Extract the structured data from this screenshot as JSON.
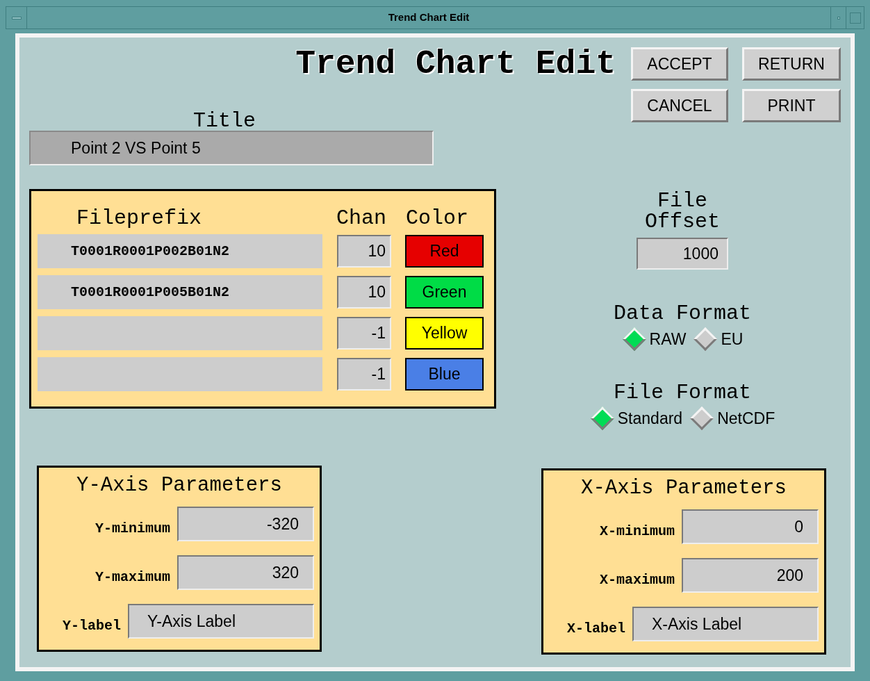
{
  "window": {
    "title": "Trend Chart Edit"
  },
  "heading": "Trend Chart Edit",
  "buttons": [
    {
      "label": "ACCEPT"
    },
    {
      "label": "RETURN"
    },
    {
      "label": "CANCEL"
    },
    {
      "label": "PRINT"
    }
  ],
  "title_field": {
    "label": "Title",
    "value": "Point 2 VS Point 5"
  },
  "channels": {
    "headers": [
      "Fileprefix",
      "Chan",
      "Color"
    ],
    "rows": [
      {
        "fileprefix": "T0001R0001P002B01N2",
        "chan": "10",
        "color_label": "Red",
        "color": "#e60000"
      },
      {
        "fileprefix": "T0001R0001P005B01N2",
        "chan": "10",
        "color_label": "Green",
        "color": "#00dc46"
      },
      {
        "chan": "-1",
        "color_label": "Yellow",
        "color": "#ffff00"
      },
      {
        "chan": "-1",
        "color_label": "Blue",
        "color": "#4a7fe6"
      }
    ]
  },
  "file_offset": {
    "label_lines": [
      "File",
      "Offset"
    ],
    "value": "1000"
  },
  "data_format": {
    "label": "Data Format",
    "options": [
      {
        "label": "RAW",
        "selected": true
      },
      {
        "label": "EU",
        "selected": false
      }
    ]
  },
  "file_format": {
    "label": "File Format",
    "options": [
      {
        "label": "Standard",
        "selected": true
      },
      {
        "label": "NetCDF",
        "selected": false
      }
    ]
  },
  "y_axis": {
    "title": "Y-Axis Parameters",
    "fields": [
      {
        "label": "Y-minimum",
        "value": "-320"
      },
      {
        "label": "Y-maximum",
        "value": "320"
      },
      {
        "label": "Y-label",
        "value": "Y-Axis Label"
      }
    ]
  },
  "x_axis": {
    "title": "X-Axis Parameters",
    "fields": [
      {
        "label": "X-minimum",
        "value": "0"
      },
      {
        "label": "X-maximum",
        "value": "200"
      },
      {
        "label": "X-label",
        "value": "X-Axis Label"
      }
    ]
  }
}
